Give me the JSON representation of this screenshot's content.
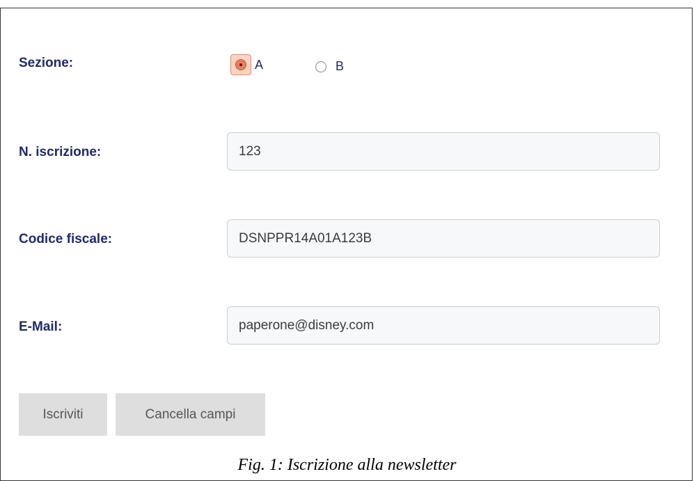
{
  "form": {
    "section": {
      "label": "Sezione:",
      "options": [
        {
          "label": "A",
          "checked": true
        },
        {
          "label": "B",
          "checked": false
        }
      ]
    },
    "registration_number": {
      "label": "N. iscrizione:",
      "value": "123"
    },
    "fiscal_code": {
      "label": "Codice fiscale:",
      "value": "DSNPPR14A01A123B"
    },
    "email": {
      "label": "E-Mail:",
      "value": "paperone@disney.com"
    },
    "buttons": {
      "subscribe": "Iscriviti",
      "clear": "Cancella campi"
    }
  },
  "caption": "Fig. 1: Iscrizione alla newsletter",
  "colors": {
    "label": "#1f2a6b",
    "radio_checked": "#e9805f",
    "input_bg": "#f6f8fa",
    "button_bg": "#dedede"
  }
}
